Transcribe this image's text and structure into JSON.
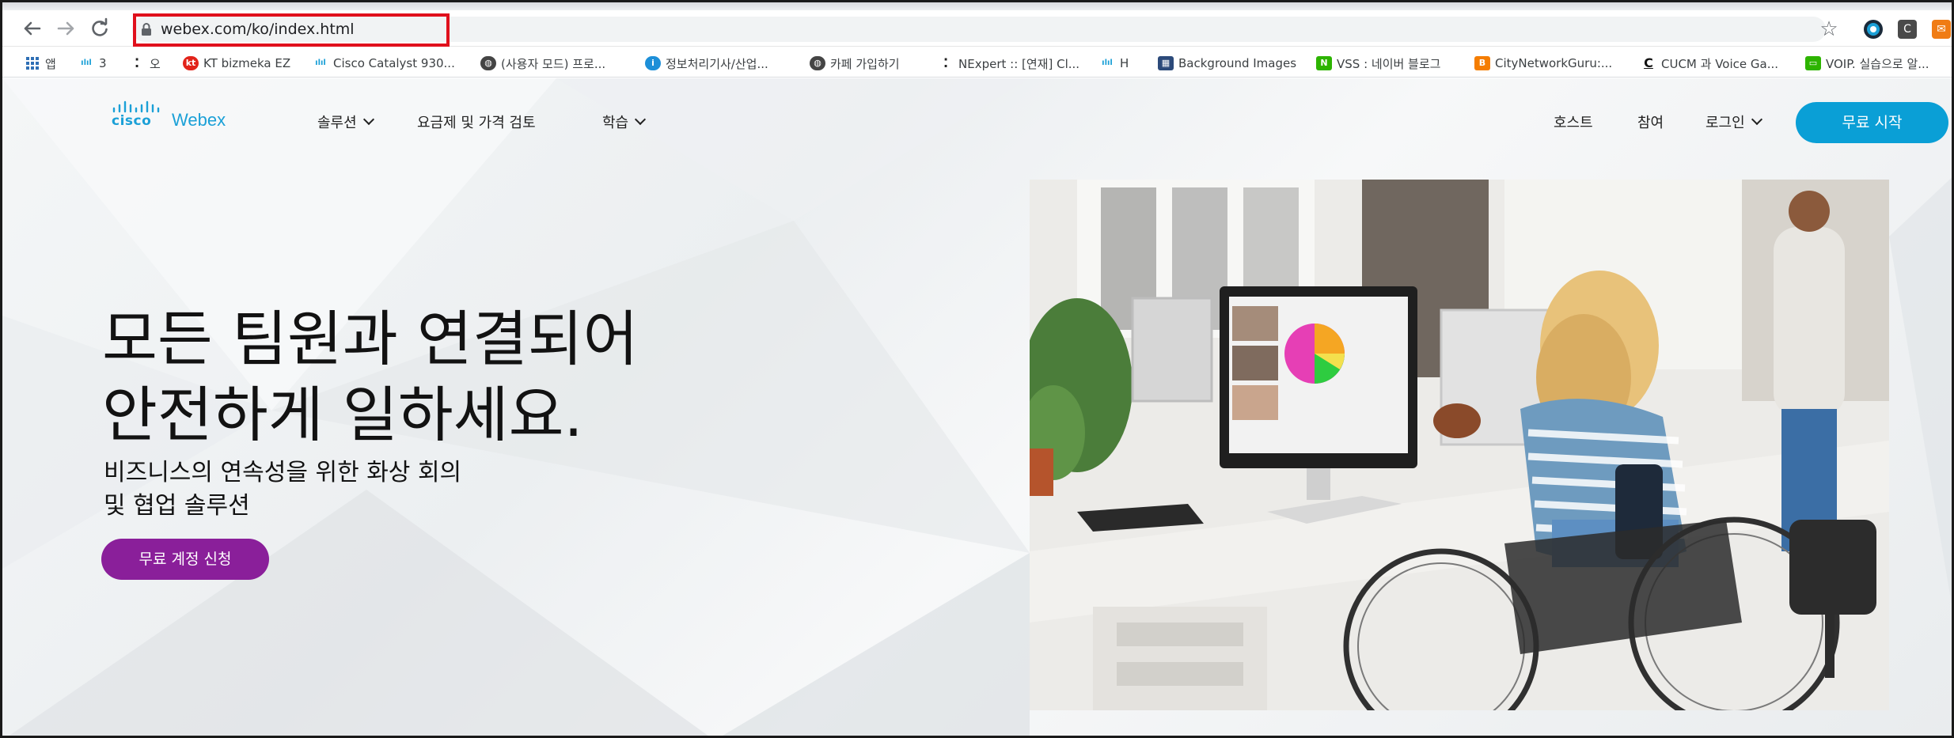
{
  "browser": {
    "url": "webex.com/ko/index.html",
    "nav_icons": [
      "back-icon",
      "forward-icon",
      "reload-icon"
    ],
    "toolbar_icons": [
      "star-icon",
      "extension-icon",
      "extension-c-icon",
      "extension-orange-icon"
    ]
  },
  "bookmarks": [
    {
      "label": "앱",
      "icon": "apps-icon"
    },
    {
      "label": "3",
      "icon": "cisco-icon"
    },
    {
      "label": "오",
      "icon": "dots-icon"
    },
    {
      "label": "KT bizmeka EZ",
      "icon": "kt-icon"
    },
    {
      "label": "Cisco Catalyst 930...",
      "icon": "cisco-icon"
    },
    {
      "label": "(사용자 모드) 프로...",
      "icon": "globe-icon"
    },
    {
      "label": "정보처리기사/산업...",
      "icon": "info-icon"
    },
    {
      "label": "카페 가입하기",
      "icon": "globe-icon"
    },
    {
      "label": "NExpert :: [연재] Cl...",
      "icon": "dots-icon"
    },
    {
      "label": "H",
      "icon": "cisco-icon"
    },
    {
      "label": "Background Images",
      "icon": "image-icon"
    },
    {
      "label": "VSS : 네이버 블로그",
      "icon": "naver-icon"
    },
    {
      "label": "CityNetworkGuru:...",
      "icon": "blogger-icon"
    },
    {
      "label": "CUCM 과 Voice Ga...",
      "icon": "c-icon"
    },
    {
      "label": "VOIP. 실습으로 알...",
      "icon": "naver-icon"
    }
  ],
  "brand": {
    "cisco": "cisco",
    "product": "Webex"
  },
  "nav": {
    "solutions": "솔루션",
    "pricing": "요금제 및 가격 검토",
    "learn": "학습",
    "host": "호스트",
    "join": "참여",
    "login": "로그인",
    "start_free": "무료 시작"
  },
  "hero": {
    "title_line1": "모든 팀원과 연결되어",
    "title_line2": "안전하게 일하세요.",
    "subtitle_line1": "비즈니스의 연속성을 위한 화상 회의",
    "subtitle_line2": "및 협업 솔루션",
    "signup": "무료 계정 신청"
  },
  "colors": {
    "brand_blue": "#0a9fd6",
    "signup_purple": "#8a1f9a",
    "url_highlight": "#e0101c"
  }
}
